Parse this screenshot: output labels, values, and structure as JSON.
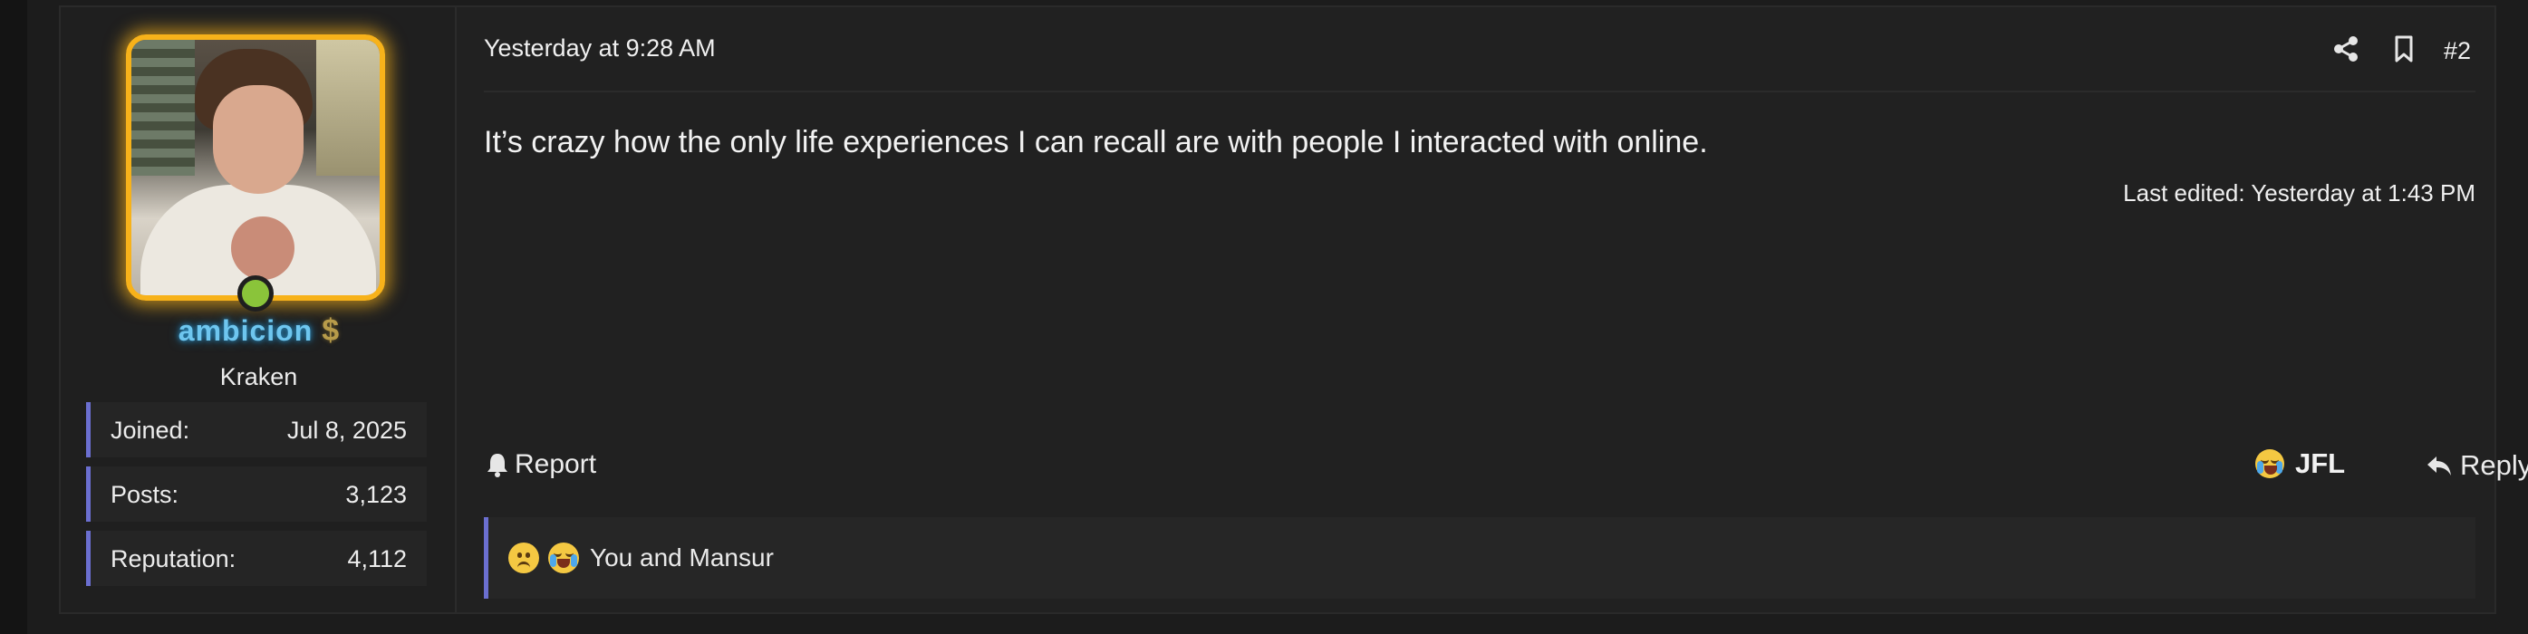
{
  "post": {
    "date": "Yesterday at 9:28 AM",
    "number": "#2",
    "message": "It’s crazy how the only life experiences I can recall are with people I interacted with online.",
    "last_edited": "Last edited: Yesterday at 1:43 PM"
  },
  "user": {
    "name": "ambicion",
    "title": "Kraken",
    "badge_icon": "dollar-sign-icon",
    "online": true,
    "stats": [
      {
        "key": "Joined:",
        "value": "Jul 8, 2025"
      },
      {
        "key": "Posts:",
        "value": "3,123"
      },
      {
        "key": "Reputation:",
        "value": "4,112"
      }
    ]
  },
  "actions": {
    "report_label": "Report",
    "reaction_label": "JFL",
    "reply_label": "Reply"
  },
  "reactions": {
    "summary": "You and Mansur",
    "icons": [
      "sad-face-icon",
      "crying-laughing-face-icon"
    ]
  },
  "colors": {
    "accent": "#6b6fd0",
    "avatar_border": "#f7b21a",
    "online_dot": "#8ac43a",
    "username": "#6ec6ef"
  }
}
